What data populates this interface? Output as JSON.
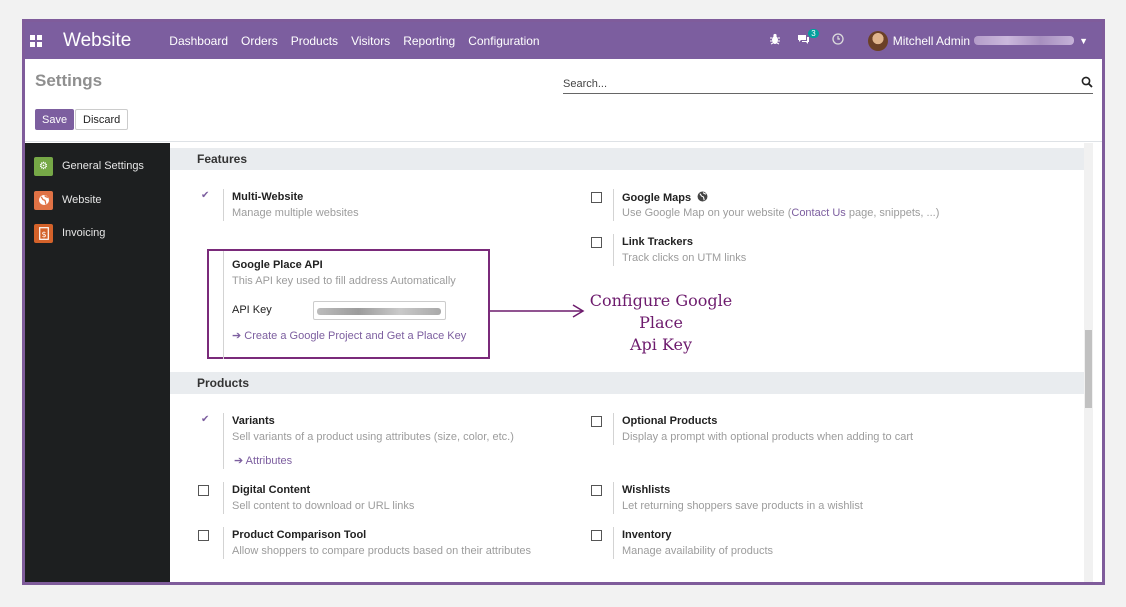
{
  "navbar": {
    "brand": "Website",
    "menu": [
      "Dashboard",
      "Orders",
      "Products",
      "Visitors",
      "Reporting",
      "Configuration"
    ],
    "chat_count": "3",
    "user_name": "Mitchell Admin",
    "icons": [
      "apps-icon",
      "bug-icon",
      "chat-icon",
      "clock-icon",
      "caret-down-icon"
    ]
  },
  "control": {
    "title": "Settings",
    "search_placeholder": "Search...",
    "save_label": "Save",
    "discard_label": "Discard"
  },
  "sidebar": {
    "items": [
      {
        "label": "General Settings",
        "icon": "gear-icon",
        "color": "#76a847"
      },
      {
        "label": "Website",
        "icon": "globe-icon",
        "color": "#e07245"
      },
      {
        "label": "Invoicing",
        "icon": "invoice-icon",
        "color": "#d4622a"
      }
    ]
  },
  "features": {
    "header": "Features",
    "multi_website": {
      "title": "Multi-Website",
      "desc": "Manage multiple websites",
      "checked": true
    },
    "google_maps": {
      "title": "Google Maps",
      "desc_pre": "Use Google Map on your website (",
      "desc_link": "Contact Us",
      "desc_post": " page, snippets, ...)",
      "checked": false
    },
    "google_place": {
      "title": "Google Place API",
      "desc": "This API key used to fill address Automatically",
      "api_key_label": "API Key",
      "link": "Create a Google Project and Get a Place Key"
    },
    "link_trackers": {
      "title": "Link Trackers",
      "desc": "Track clicks on UTM links",
      "checked": false
    }
  },
  "products": {
    "header": "Products",
    "variants": {
      "title": "Variants",
      "desc": "Sell variants of a product using attributes (size, color, etc.)",
      "link": "Attributes",
      "checked": true
    },
    "optional_products": {
      "title": "Optional Products",
      "desc": "Display a prompt with optional products when adding to cart",
      "checked": false
    },
    "digital_content": {
      "title": "Digital Content",
      "desc": "Sell content to download or URL links",
      "checked": false
    },
    "wishlists": {
      "title": "Wishlists",
      "desc": "Let returning shoppers save products in a wishlist",
      "checked": false
    },
    "comparison": {
      "title": "Product Comparison Tool",
      "desc": "Allow shoppers to compare products based on their attributes",
      "checked": false
    },
    "inventory": {
      "title": "Inventory",
      "desc": "Manage availability of products",
      "checked": false
    }
  },
  "annotation": {
    "line1": "Configure Google Place",
    "line2": "Api Key",
    "color": "#6d1b6d"
  },
  "colors": {
    "primary": "#7c5e9f",
    "sidebar_bg": "#1d1f20"
  }
}
